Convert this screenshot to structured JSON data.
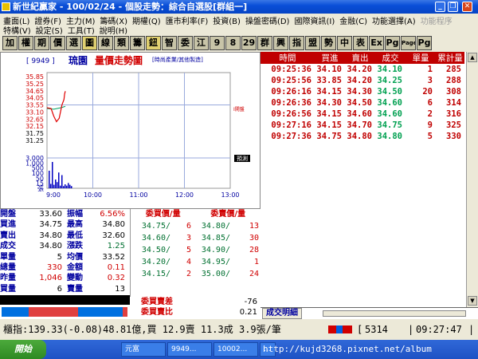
{
  "window": {
    "title": "新世紀贏家 - 100/02/24 - 個股走勢：綜合自選股[群組一]"
  },
  "menu": {
    "row1": [
      "畫面(L)",
      "證券(F)",
      "主力(M)",
      "籌碼(X)",
      "期權(Q)",
      "匯市利率(F)",
      "投資(B)",
      "操盤密碼(D)",
      "國際資訊(I)",
      "金融(C)",
      "功能選擇(A)"
    ],
    "row1_disabled": [
      "功能程序"
    ],
    "row2": [
      "特構(V)",
      "設定(S)",
      "工具(T)",
      "說明(H)"
    ]
  },
  "toolbar": [
    "加",
    "權",
    "期",
    "價",
    "選",
    "圖",
    "線",
    "類",
    "籌",
    "鈕",
    "智",
    "委",
    "江",
    "9",
    "8",
    "29",
    "群",
    "興",
    "指",
    "盟",
    "勢",
    "中",
    "表",
    "Ex",
    "Pg",
    "Page",
    "Pg"
  ],
  "chart": {
    "code": "[ 9949 ]",
    "name": "琉園",
    "title": "量價走勢圖",
    "category": "[時尚產業/其他製造]",
    "right_label_1": "I開盤",
    "right_label_2": "預測"
  },
  "chart_data": {
    "type": "line",
    "ylabel": "",
    "y_ticks": [
      "35.85",
      "35.25",
      "34.65",
      "34.05",
      "33.55",
      "33.10",
      "32.65",
      "32.15",
      "31.75",
      "31.25"
    ],
    "vol_ticks": [
      "3,000",
      "1,000",
      "500",
      "100",
      "50",
      "15",
      "張"
    ],
    "x_ticks": [
      "9:00",
      "10:00",
      "11:00",
      "12:00",
      "13:00"
    ],
    "ylim": [
      31.25,
      35.85
    ],
    "price_series": {
      "name": "成交",
      "x": [
        "9:00",
        "9:06",
        "9:10",
        "9:14",
        "9:18",
        "9:22",
        "9:25",
        "9:26",
        "9:27"
      ],
      "values": [
        33.6,
        33.55,
        33.0,
        32.6,
        32.85,
        33.8,
        34.2,
        34.6,
        34.8
      ]
    },
    "avg_series": {
      "name": "均價",
      "x": [
        "9:00",
        "9:10",
        "9:20",
        "9:27"
      ],
      "values": [
        33.55,
        33.5,
        33.6,
        33.7
      ]
    },
    "volume": [
      40,
      10,
      60,
      8,
      20,
      14,
      36,
      6,
      30,
      5,
      9,
      6,
      12,
      8,
      5
    ]
  },
  "quote": [
    {
      "l": "開盤",
      "v": "33.60",
      "l2": "振幅",
      "v2": "6.56%",
      "c1": "",
      "c2": "red"
    },
    {
      "l": "買進",
      "v": "34.75",
      "l2": "最高",
      "v2": "34.80",
      "c1": "",
      "c2": ""
    },
    {
      "l": "賣出",
      "v": "34.80",
      "l2": "最低",
      "v2": "32.60",
      "c1": "",
      "c2": ""
    },
    {
      "l": "成交",
      "v": "34.80",
      "l2": "漲跌",
      "v2": "1.25",
      "c1": "",
      "c2": "grn"
    },
    {
      "l": "單量",
      "v": "5",
      "l2": "均價",
      "v2": "33.52",
      "c1": "",
      "c2": ""
    },
    {
      "l": "總量",
      "v": "330",
      "l2": "金額",
      "v2": "0.11",
      "c1": "",
      "c2": "red"
    },
    {
      "l": "昨量",
      "v": "1,046",
      "l2": "變動",
      "v2": "0.32",
      "c1": "",
      "c2": "red"
    },
    {
      "l": "買量",
      "v": "6",
      "l2": "賣量",
      "v2": "13",
      "c1": "",
      "c2": ""
    }
  ],
  "book": {
    "bid_header": "委買價/量",
    "ask_header": "委賣價/量",
    "rows": [
      {
        "bp": "34.75/",
        "bq": "6",
        "ap": "34.80/",
        "aq": "13"
      },
      {
        "bp": "34.60/",
        "bq": "3",
        "ap": "34.85/",
        "aq": "30"
      },
      {
        "bp": "34.50/",
        "bq": "5",
        "ap": "34.90/",
        "aq": "28"
      },
      {
        "bp": "34.20/",
        "bq": "4",
        "ap": "34.95/",
        "aq": "1"
      },
      {
        "bp": "34.15/",
        "bq": "2",
        "ap": "35.00/",
        "aq": "24"
      }
    ],
    "diff_label": "委買賣差",
    "diff_value": "-76",
    "ratio_label": "委買賣比",
    "ratio_value": "0.21"
  },
  "ticks": {
    "headers": [
      "時間",
      "買進",
      "賣出",
      "成交",
      "單量",
      "累計量"
    ],
    "rows": [
      [
        "09:25:36",
        "34.10",
        "34.20",
        "34.10",
        "1",
        "285"
      ],
      [
        "09:25:56",
        "33.85",
        "34.20",
        "34.25",
        "3",
        "288"
      ],
      [
        "09:26:16",
        "34.15",
        "34.30",
        "34.50",
        "20",
        "308"
      ],
      [
        "09:26:36",
        "34.30",
        "34.50",
        "34.60",
        "6",
        "314"
      ],
      [
        "09:26:56",
        "34.15",
        "34.60",
        "34.60",
        "2",
        "316"
      ],
      [
        "09:27:16",
        "34.15",
        "34.70",
        "34.75",
        "9",
        "325"
      ],
      [
        "09:27:36",
        "34.75",
        "34.80",
        "34.80",
        "5",
        "330"
      ]
    ],
    "tab_label": "成交明細"
  },
  "status": {
    "left": "櫃指:139.33(-0.08)48.81億,買 12.9賣 11.3成 3.9張/筆",
    "count": "5314",
    "time": "09:27:47"
  },
  "taskbar": {
    "start": "開始",
    "items": [
      "元富",
      "9949...",
      "10002...",
      "..."
    ],
    "watermark": "http://kujd3268.pixnet.net/album"
  },
  "colors": {
    "up": "#d00000",
    "down": "#007030",
    "header": "#c00000"
  }
}
